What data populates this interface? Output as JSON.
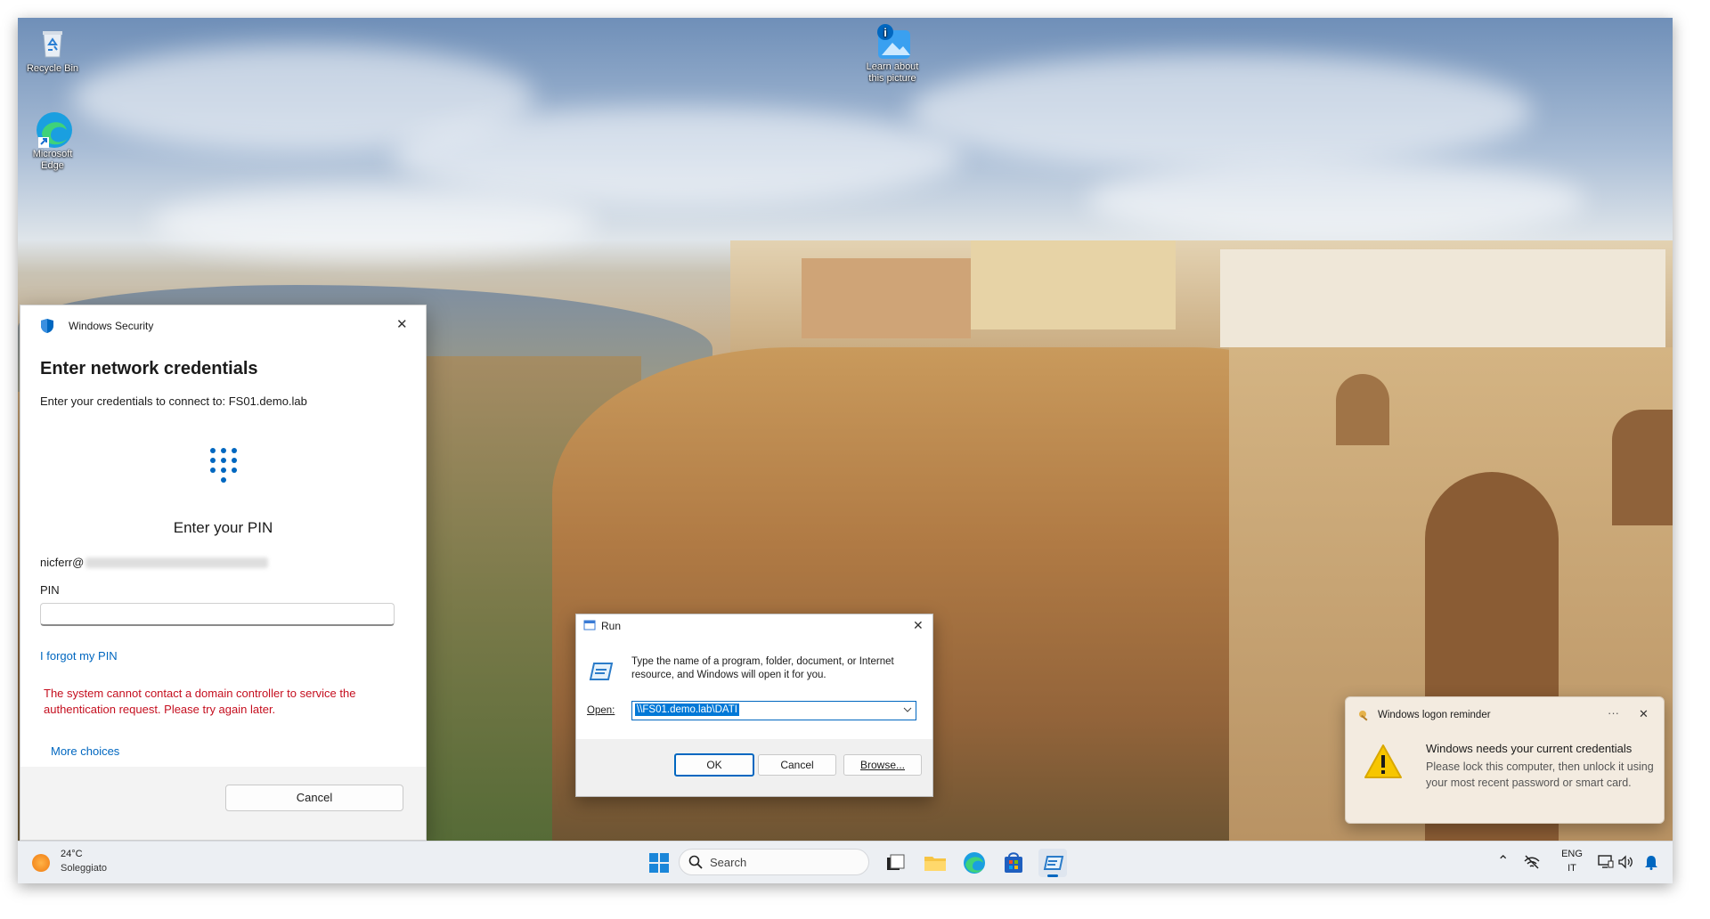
{
  "desktop": {
    "icons": [
      {
        "label_line1": "Recycle Bin",
        "label_line2": ""
      },
      {
        "label_line1": "Microsoft",
        "label_line2": "Edge"
      },
      {
        "label_line1": "Learn about",
        "label_line2": "this picture"
      }
    ]
  },
  "windows_security": {
    "app_title": "Windows Security",
    "heading": "Enter network credentials",
    "subtitle": "Enter your credentials to connect to: FS01.demo.lab",
    "pin_prompt": "Enter your PIN",
    "username": "nicferr@",
    "pin_label": "PIN",
    "pin_value": "",
    "forgot_pin": "I forgot my PIN",
    "error": "The system cannot contact a domain controller to service the authentication request. Please try again later.",
    "more_choices": "More choices",
    "cancel": "Cancel",
    "close_glyph": "✕"
  },
  "run_dialog": {
    "title": "Run",
    "description": "Type the name of a program, folder, document, or Internet resource, and Windows will open it for you.",
    "open_label": "Open:",
    "open_value": "\\\\FS01.demo.lab\\DATI",
    "ok": "OK",
    "cancel": "Cancel",
    "browse": "Browse...",
    "close_glyph": "✕"
  },
  "toast": {
    "app_name": "Windows logon reminder",
    "title": "Windows needs your current credentials",
    "body": "Please lock this computer, then unlock it using your most recent password or smart card.",
    "more_glyph": "···",
    "close_glyph": "✕"
  },
  "taskbar": {
    "weather_temp": "24°C",
    "weather_desc": "Soleggiato",
    "search_placeholder": "Search",
    "lang_top": "ENG",
    "lang_bottom": "IT",
    "chevron_glyph": "⌃"
  },
  "colors": {
    "accent": "#0067c0",
    "error_red": "#c50f1f",
    "warning_yellow": "#f7c600"
  }
}
